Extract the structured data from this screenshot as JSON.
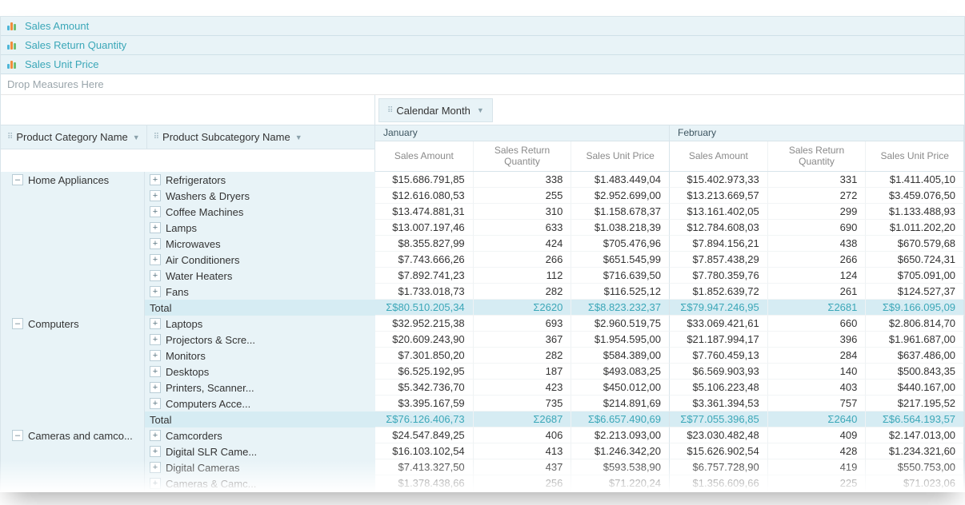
{
  "measures": [
    {
      "label": "Sales Amount"
    },
    {
      "label": "Sales Return Quantity"
    },
    {
      "label": "Sales Unit Price"
    }
  ],
  "dropHint": "Drop Measures Here",
  "rowDims": {
    "cat": "Product Category Name",
    "sub": "Product Subcategory Name"
  },
  "colDim": "Calendar Month",
  "months": [
    "January",
    "February"
  ],
  "valueHeaders": [
    "Sales Amount",
    "Sales Return Quantity",
    "Sales Unit Price"
  ],
  "totalLabel": "Total",
  "groups": [
    {
      "category": "Home Appliances",
      "rows": [
        {
          "sub": "Refrigerators",
          "v": [
            "$15.686.791,85",
            "338",
            "$1.483.449,04",
            "$15.402.973,33",
            "331",
            "$1.411.405,10"
          ]
        },
        {
          "sub": "Washers & Dryers",
          "v": [
            "$12.616.080,53",
            "255",
            "$2.952.699,00",
            "$13.213.669,57",
            "272",
            "$3.459.076,50"
          ]
        },
        {
          "sub": "Coffee Machines",
          "v": [
            "$13.474.881,31",
            "310",
            "$1.158.678,37",
            "$13.161.402,05",
            "299",
            "$1.133.488,93"
          ]
        },
        {
          "sub": "Lamps",
          "v": [
            "$13.007.197,46",
            "633",
            "$1.038.218,39",
            "$12.784.608,03",
            "690",
            "$1.011.202,20"
          ]
        },
        {
          "sub": "Microwaves",
          "v": [
            "$8.355.827,99",
            "424",
            "$705.476,96",
            "$7.894.156,21",
            "438",
            "$670.579,68"
          ]
        },
        {
          "sub": "Air Conditioners",
          "v": [
            "$7.743.666,26",
            "266",
            "$651.545,99",
            "$7.857.438,29",
            "266",
            "$650.724,31"
          ]
        },
        {
          "sub": "Water Heaters",
          "v": [
            "$7.892.741,23",
            "112",
            "$716.639,50",
            "$7.780.359,76",
            "124",
            "$705.091,00"
          ]
        },
        {
          "sub": "Fans",
          "v": [
            "$1.733.018,73",
            "282",
            "$116.525,12",
            "$1.852.639,72",
            "261",
            "$124.527,37"
          ]
        }
      ],
      "total": [
        "$80.510.205,34",
        "2620",
        "$8.823.232,37",
        "$79.947.246,95",
        "2681",
        "$9.166.095,09"
      ]
    },
    {
      "category": "Computers",
      "rows": [
        {
          "sub": "Laptops",
          "v": [
            "$32.952.215,38",
            "693",
            "$2.960.519,75",
            "$33.069.421,61",
            "660",
            "$2.806.814,70"
          ]
        },
        {
          "sub": "Projectors & Scre...",
          "v": [
            "$20.609.243,90",
            "367",
            "$1.954.595,00",
            "$21.187.994,17",
            "396",
            "$1.961.687,00"
          ]
        },
        {
          "sub": "Monitors",
          "v": [
            "$7.301.850,20",
            "282",
            "$584.389,00",
            "$7.760.459,13",
            "284",
            "$637.486,00"
          ]
        },
        {
          "sub": "Desktops",
          "v": [
            "$6.525.192,95",
            "187",
            "$493.083,25",
            "$6.569.903,93",
            "140",
            "$500.843,35"
          ]
        },
        {
          "sub": "Printers, Scanner...",
          "v": [
            "$5.342.736,70",
            "423",
            "$450.012,00",
            "$5.106.223,48",
            "403",
            "$440.167,00"
          ]
        },
        {
          "sub": "Computers Acce...",
          "v": [
            "$3.395.167,59",
            "735",
            "$214.891,69",
            "$3.361.394,53",
            "757",
            "$217.195,52"
          ]
        }
      ],
      "total": [
        "$76.126.406,73",
        "2687",
        "$6.657.490,69",
        "$77.055.396,85",
        "2640",
        "$6.564.193,57"
      ]
    },
    {
      "category": "Cameras and camco...",
      "rows": [
        {
          "sub": "Camcorders",
          "v": [
            "$24.547.849,25",
            "406",
            "$2.213.093,00",
            "$23.030.482,48",
            "409",
            "$2.147.013,00"
          ]
        },
        {
          "sub": "Digital SLR Came...",
          "v": [
            "$16.103.102,54",
            "413",
            "$1.246.342,20",
            "$15.626.902,54",
            "428",
            "$1.234.321,60"
          ]
        },
        {
          "sub": "Digital Cameras",
          "v": [
            "$7.413.327,50",
            "437",
            "$593.538,90",
            "$6.757.728,90",
            "419",
            "$550.753,00"
          ]
        },
        {
          "sub": "Cameras & Camc...",
          "v": [
            "$1.378.438,66",
            "256",
            "$71.220,24",
            "$1.356.609,66",
            "225",
            "$71.023,06"
          ]
        }
      ]
    }
  ]
}
